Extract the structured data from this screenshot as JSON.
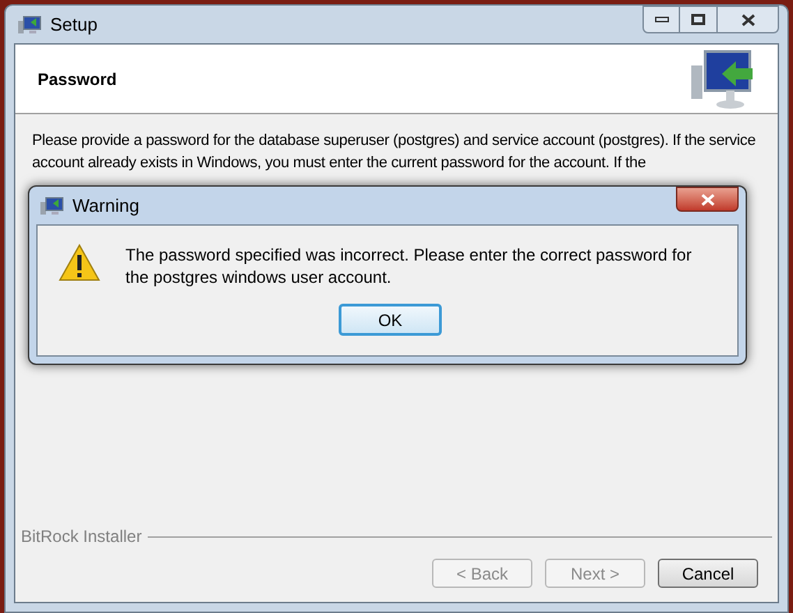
{
  "window": {
    "title": "Setup"
  },
  "header": {
    "title": "Password"
  },
  "intro": "Please provide a password for the database superuser (postgres) and service account (postgres). If the service account already exists in Windows, you must enter the current password for the account. If the",
  "footer": {
    "brand": "BitRock Installer"
  },
  "buttons": [
    {
      "label": "< Back",
      "disabled": true
    },
    {
      "label": "Next >",
      "disabled": true
    },
    {
      "label": "Cancel",
      "disabled": false
    }
  ],
  "dialog": {
    "title": "Warning",
    "message": "The password specified was incorrect. Please enter the correct password for the postgres windows user account.",
    "button": {
      "label": "OK",
      "focused": true
    }
  }
}
